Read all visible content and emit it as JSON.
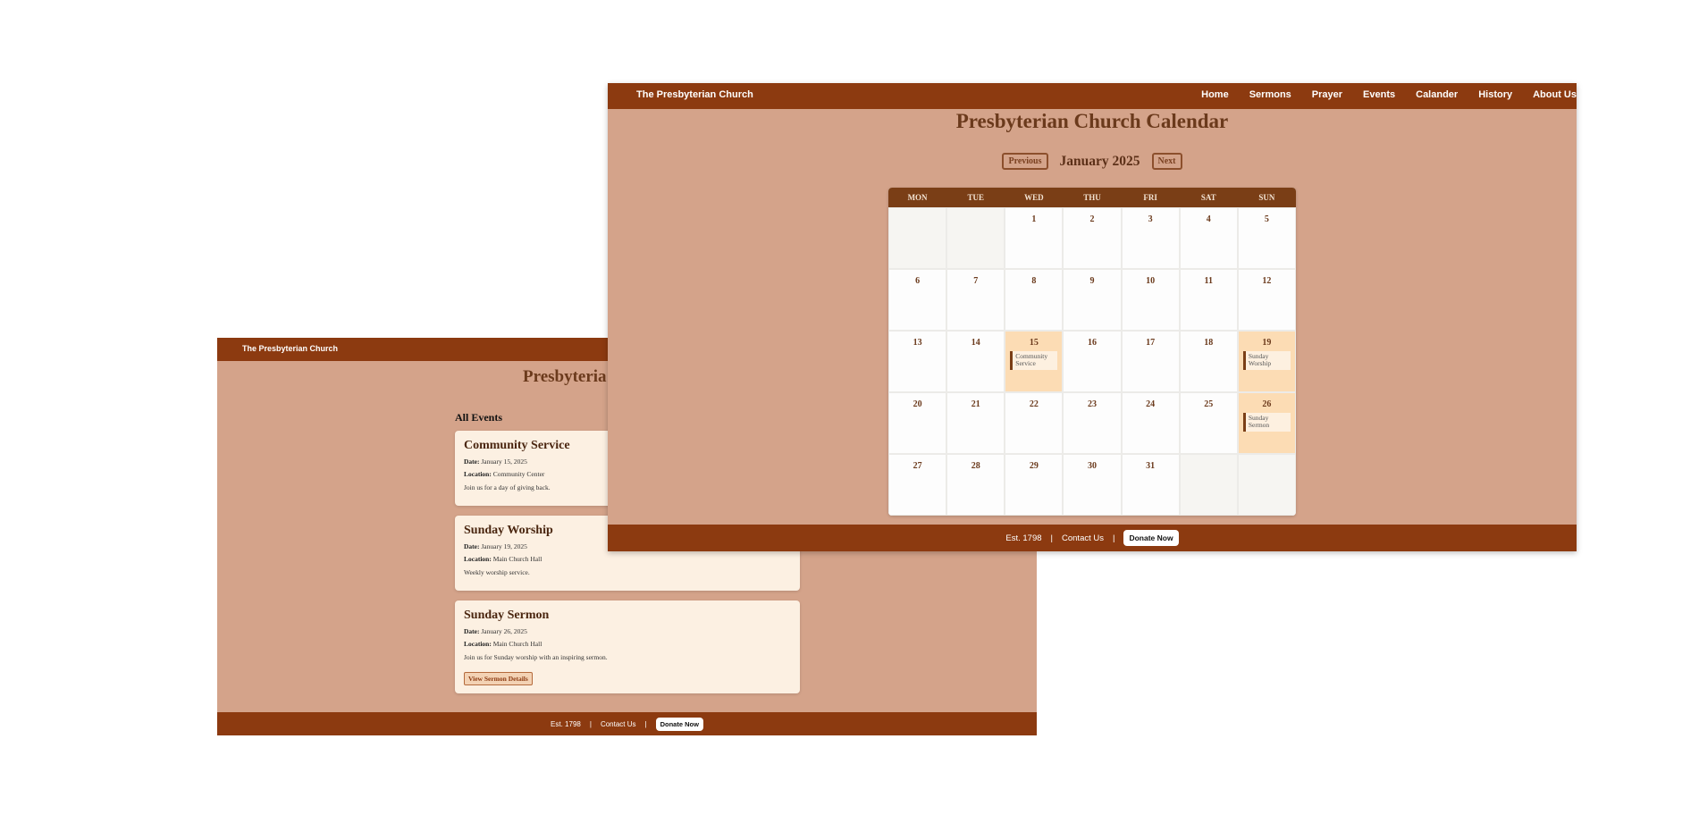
{
  "events_page": {
    "navbar": {
      "brand": "The Presbyterian Church"
    },
    "title": "Presbyteria",
    "section_heading": "All Events",
    "date_label": "Date:",
    "location_label": "Location:",
    "events": [
      {
        "title": "Community Service",
        "date": "January 15, 2025",
        "location": "Community Center",
        "description": "Join us for a day of giving back."
      },
      {
        "title": "Sunday Worship",
        "date": "January 19, 2025",
        "location": "Main Church Hall",
        "description": "Weekly worship service."
      },
      {
        "title": "Sunday Sermon",
        "date": "January 26, 2025",
        "location": "Main Church Hall",
        "description": "Join us for Sunday worship with an inspiring sermon.",
        "button": "View Sermon Details"
      }
    ],
    "footer": {
      "est": "Est. 1798",
      "separator": "|",
      "contact": "Contact Us",
      "donate": "Donate Now"
    }
  },
  "calendar_page": {
    "navbar": {
      "brand": "The Presbyterian Church",
      "links": [
        "Home",
        "Sermons",
        "Prayer",
        "Events",
        "Calander",
        "History",
        "About Us"
      ]
    },
    "title": "Presbyterian Church Calendar",
    "month_nav": {
      "previous": "Previous",
      "month": "January 2025",
      "next": "Next"
    },
    "weekdays": [
      "MON",
      "TUE",
      "WED",
      "THU",
      "FRI",
      "SAT",
      "SUN"
    ],
    "leading_blank_days": 2,
    "days_in_month": 31,
    "events": {
      "15": "Community Service",
      "19": "Sunday Worship",
      "26": "Sunday Sermon"
    },
    "footer": {
      "est": "Est. 1798",
      "separator": "|",
      "contact": "Contact Us",
      "donate": "Donate Now"
    }
  },
  "colors": {
    "navbar": "#8c3a10",
    "page_background": "#d4a38a",
    "card_background": "#fcf0e2",
    "calendar_header": "#7a3e16",
    "event_day_highlight": "#fcdcb4"
  }
}
